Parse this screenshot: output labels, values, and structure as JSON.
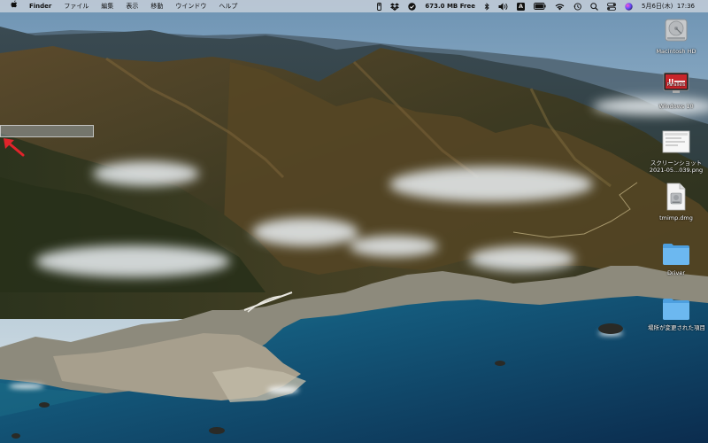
{
  "menubar": {
    "app_name": "Finder",
    "menus": [
      "ファイル",
      "編集",
      "表示",
      "移動",
      "ウインドウ",
      "ヘルプ"
    ],
    "memory_status": "673.0 MB Free",
    "input_source": "A",
    "datetime": "5月6日(木)  17:36"
  },
  "desktop": {
    "icons": [
      {
        "label": "Macintosh HD",
        "icon": "hard-drive-icon"
      },
      {
        "label": "Parallels",
        "icon": "parallels-icon"
      },
      {
        "label": "Windows 10",
        "icon": "windows-volume-icon"
      },
      {
        "label": "スクリーンショット",
        "label2": "2021-05...039.png",
        "icon": "screenshot-file-icon"
      },
      {
        "label": "tmimp.dmg",
        "icon": "disk-image-icon"
      },
      {
        "label": "Driver",
        "icon": "folder-icon"
      },
      {
        "label": "場所が変更された項目",
        "icon": "folder-icon"
      }
    ]
  },
  "annotation": {
    "arrow_color": "#e0242b"
  }
}
